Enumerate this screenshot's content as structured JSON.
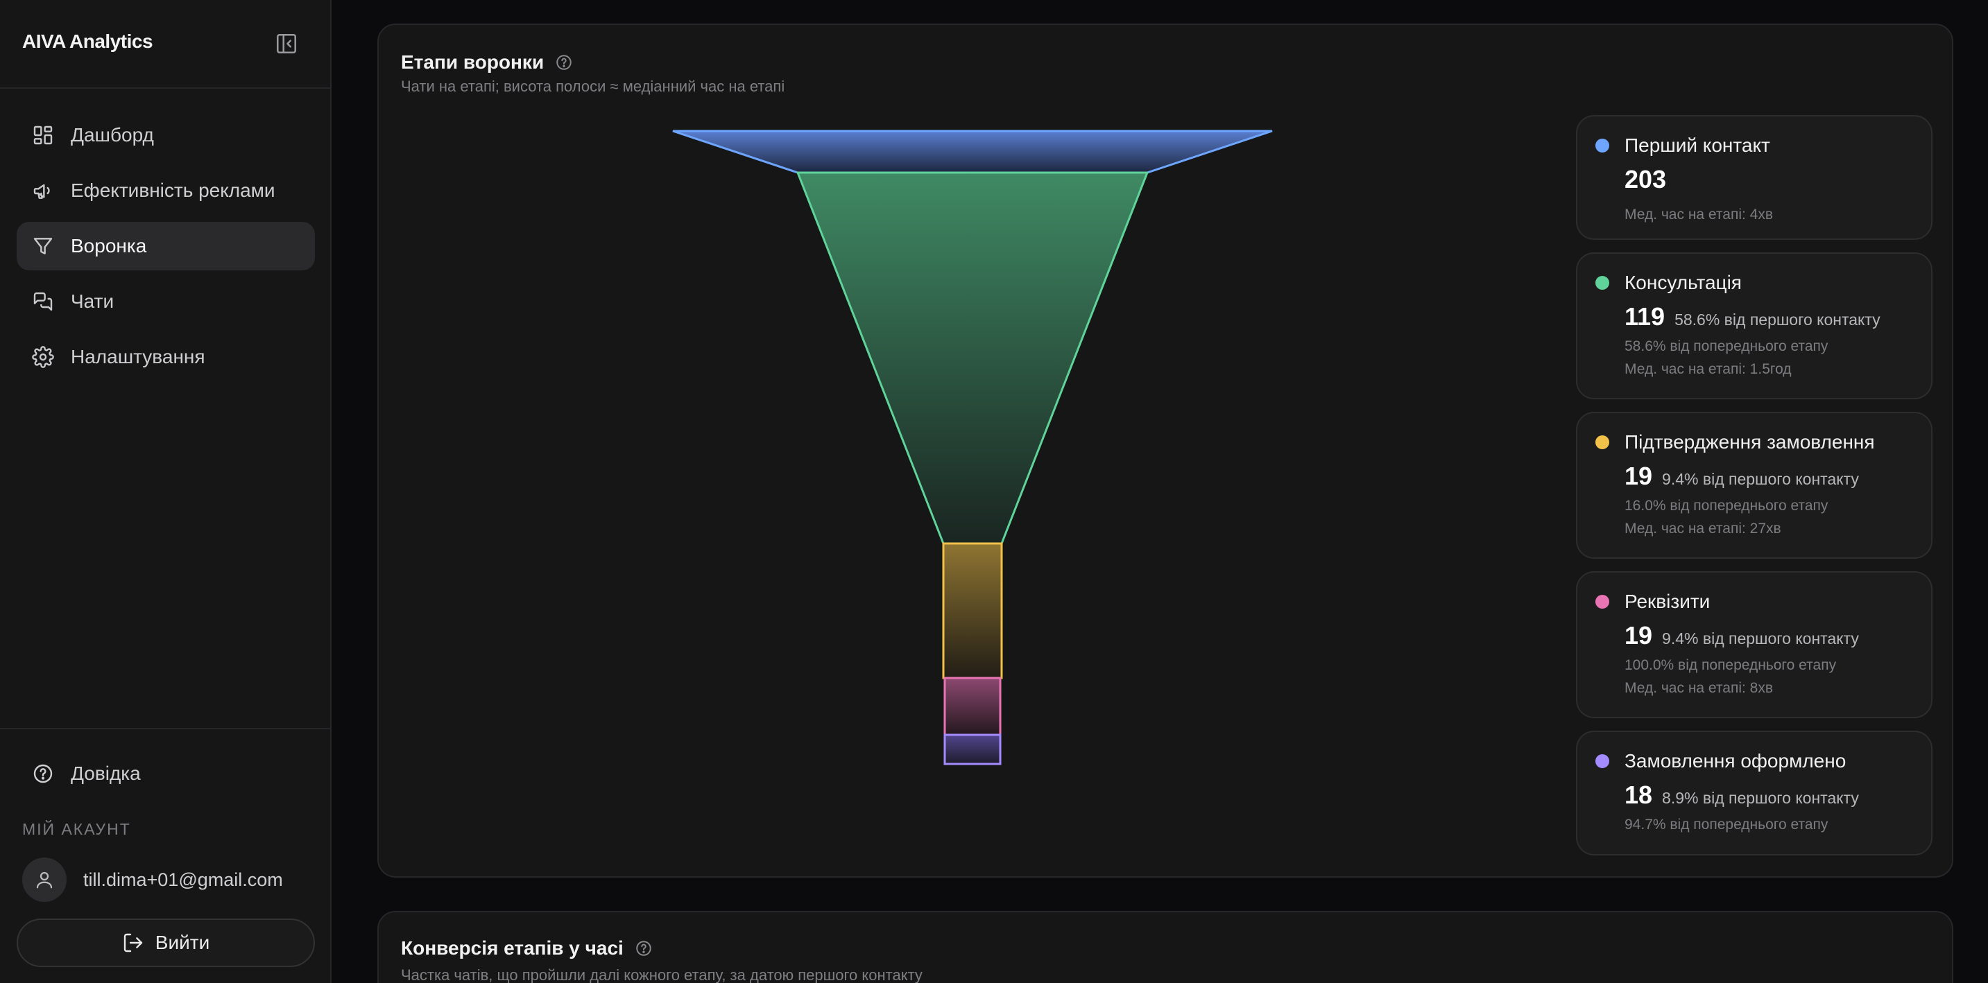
{
  "app": {
    "brand": "AIVA Analytics"
  },
  "sidebar": {
    "items": [
      {
        "label": "Дашборд",
        "icon": "dashboard-icon"
      },
      {
        "label": "Ефективність реклами",
        "icon": "megaphone-icon"
      },
      {
        "label": "Воронка",
        "icon": "funnel-icon",
        "active": true
      },
      {
        "label": "Чати",
        "icon": "chat-icon"
      },
      {
        "label": "Налаштування",
        "icon": "gear-icon"
      }
    ],
    "help_label": "Довідка",
    "account_label": "МІЙ АКАУНТ",
    "account_email": "till.dima+01@gmail.com",
    "logout_label": "Вийти"
  },
  "funnel_card": {
    "title": "Етапи воронки",
    "subtitle": "Чати на етапі; висота полоси ≈ медіанний час на етапі",
    "stages": [
      {
        "name": "Перший контакт",
        "count": "203",
        "pct_first": "",
        "pct_prev": "",
        "median": "Мед. час на етапі: 4хв",
        "color": "#6ea6ff"
      },
      {
        "name": "Консультація",
        "count": "119",
        "pct_first": "58.6% від першого контакту",
        "pct_prev": "58.6% від попереднього етапу",
        "median": "Мед. час на етапі: 1.5год",
        "color": "#5fd39a"
      },
      {
        "name": "Підтвердження замовлення",
        "count": "19",
        "pct_first": "9.4% від першого контакту",
        "pct_prev": "16.0% від попереднього етапу",
        "median": "Мед. час на етапі: 27хв",
        "color": "#f2c14a"
      },
      {
        "name": "Реквізити",
        "count": "19",
        "pct_first": "9.4% від першого контакту",
        "pct_prev": "100.0% від попереднього етапу",
        "median": "Мед. час на етапі: 8хв",
        "color": "#e874b4"
      },
      {
        "name": "Замовлення оформлено",
        "count": "18",
        "pct_first": "8.9% від першого контакту",
        "pct_prev": "94.7% від попереднього етапу",
        "median": "",
        "color": "#a48bff"
      }
    ]
  },
  "conversion_card": {
    "title": "Конверсія етапів у часі",
    "subtitle": "Частка чатів, що пройшли далі кожного етапу, за датою першого контакту"
  }
}
